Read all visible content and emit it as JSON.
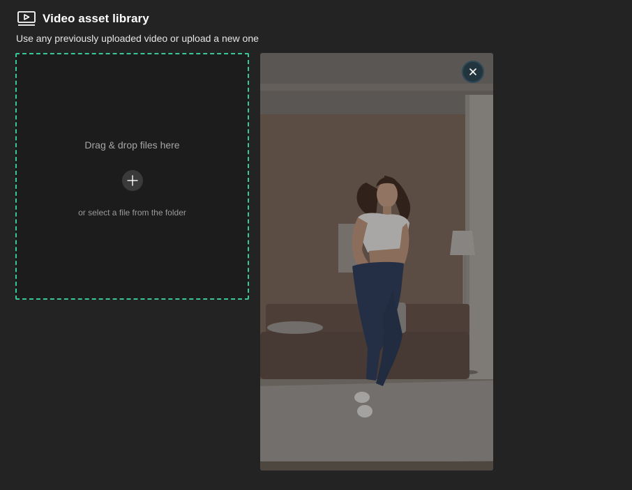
{
  "header": {
    "title": "Video asset library",
    "subtitle": "Use any previously uploaded video or upload a new one",
    "icon": "video-play-icon"
  },
  "dropzone": {
    "title": "Drag & drop files here",
    "subtitle": "or select a file from the folder",
    "add_icon": "plus-icon",
    "border_color": "#3cc79a"
  },
  "preview": {
    "close_icon": "close-icon",
    "content": "video-thumbnail"
  },
  "colors": {
    "background": "#232323",
    "dropzone_bg": "#1c1c1c",
    "accent": "#3cc79a"
  }
}
